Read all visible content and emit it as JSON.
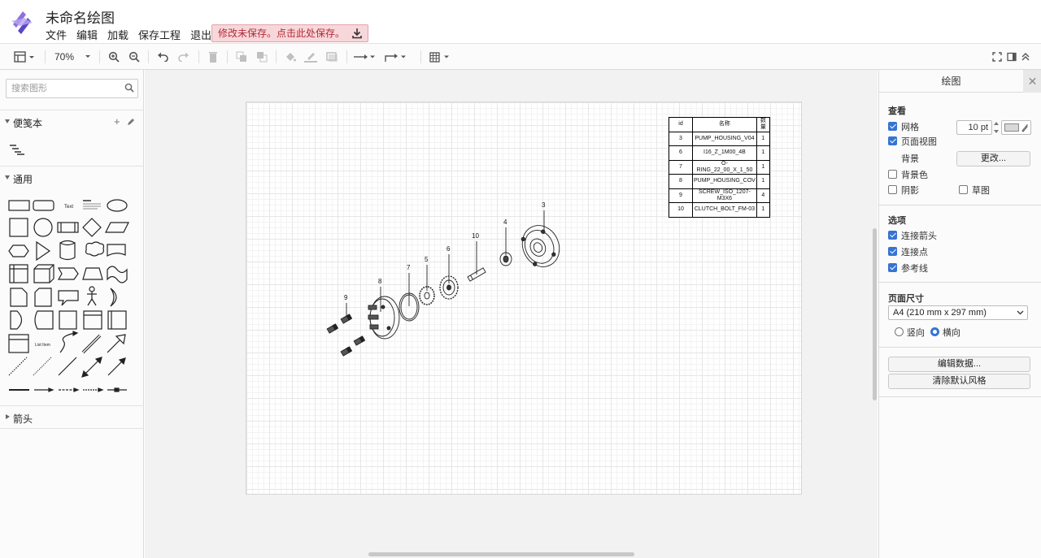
{
  "app": {
    "title": "未命名绘图",
    "menu": [
      "文件",
      "编辑",
      "加载",
      "保存工程",
      "退出"
    ],
    "save_alert": "修改未保存。点击此处保存。"
  },
  "toolbar": {
    "zoom": "70%"
  },
  "sidebar": {
    "search_placeholder": "搜索图形",
    "sections": {
      "scratchpad": "便笺本",
      "general": "通用",
      "arrows": "箭头"
    },
    "shape_text": {
      "text": "Text",
      "heading": "Heading",
      "list_item": "List Item"
    }
  },
  "diagram": {
    "bom_headers": [
      "id",
      "名称",
      "数量"
    ],
    "bom_rows": [
      [
        "3",
        "PUMP_HOUSING_V04",
        "1"
      ],
      [
        "6",
        "I16_Z_1M00_4B",
        "1"
      ],
      [
        "7",
        "O-RING_22_00_X_1_50",
        "1"
      ],
      [
        "8",
        "PUMP_HOUSING_COV",
        "1"
      ],
      [
        "9",
        "SCREW_ISO_1207-M3X6",
        "4"
      ],
      [
        "10",
        "CLUTCH_BOLT_FM-03",
        "1"
      ]
    ],
    "callouts": [
      "3",
      "4",
      "10",
      "6",
      "5",
      "7",
      "8",
      "9"
    ]
  },
  "format_panel": {
    "title": "绘图",
    "view_heading": "查看",
    "grid_label": "网格",
    "grid_size": "10 pt",
    "page_view_label": "页面视图",
    "background_label": "背景",
    "change_button": "更改...",
    "background_color_label": "背景色",
    "shadow_label": "阴影",
    "sketch_label": "草图",
    "options_heading": "选项",
    "connection_arrows": "连接箭头",
    "connection_points": "连接点",
    "guides": "参考线",
    "page_size_heading": "页面尺寸",
    "page_size_value": "A4 (210 mm x 297 mm)",
    "portrait": "竖向",
    "landscape": "横向",
    "edit_data_button": "编辑数据...",
    "clear_style_button": "清除默认风格",
    "grid_checked": true,
    "page_view_checked": true,
    "background_color_checked": false,
    "shadow_checked": false,
    "sketch_checked": false,
    "connection_arrows_checked": true,
    "connection_points_checked": true,
    "guides_checked": true,
    "orientation": "landscape"
  }
}
